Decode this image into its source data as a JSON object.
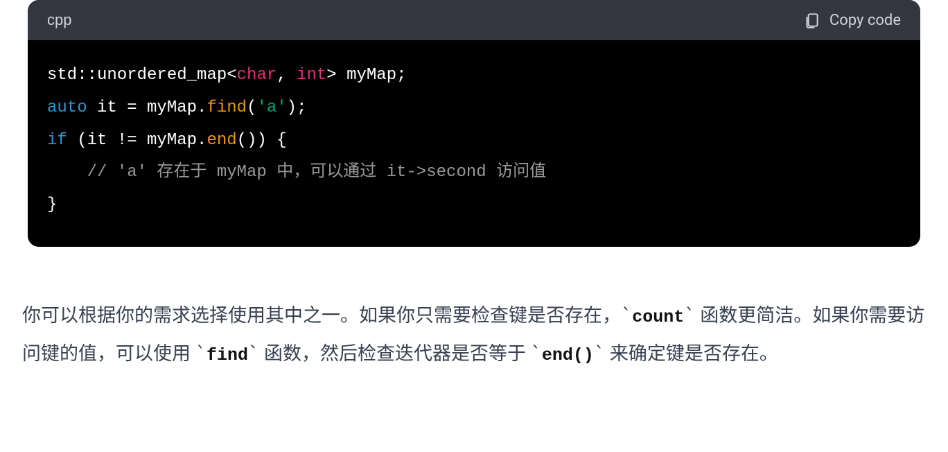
{
  "code_block": {
    "language": "cpp",
    "copy_label": "Copy code",
    "lines": {
      "l1_std": "std::unordered_map<",
      "l1_char": "char",
      "l1_comma": ", ",
      "l1_int": "int",
      "l1_end": "> myMap;",
      "l2_auto": "auto",
      "l2_it": " it = myMap.",
      "l2_find": "find",
      "l2_paren_open": "(",
      "l2_str": "'a'",
      "l2_paren_close": ");",
      "l3_if": "if",
      "l3_cond": " (it != myMap.",
      "l3_end": "end",
      "l3_close": "()) {",
      "l4_indent": "    ",
      "l4_comment": "// 'a' 存在于 myMap 中，可以通过 it->second 访问值",
      "l5_brace": "}"
    }
  },
  "explanation": {
    "part1": "你可以根据你的需求选择使用其中之一。如果你只需要检查键是否存在，",
    "bt": "`",
    "code1": "count",
    "part2": " 函数更简洁。如果你需要访问键的值，可以使用 ",
    "code2": "find",
    "part3": " 函数，然后检查迭代器是否等于 ",
    "code3": "end()",
    "part4": " 来确定键是否存在。"
  }
}
